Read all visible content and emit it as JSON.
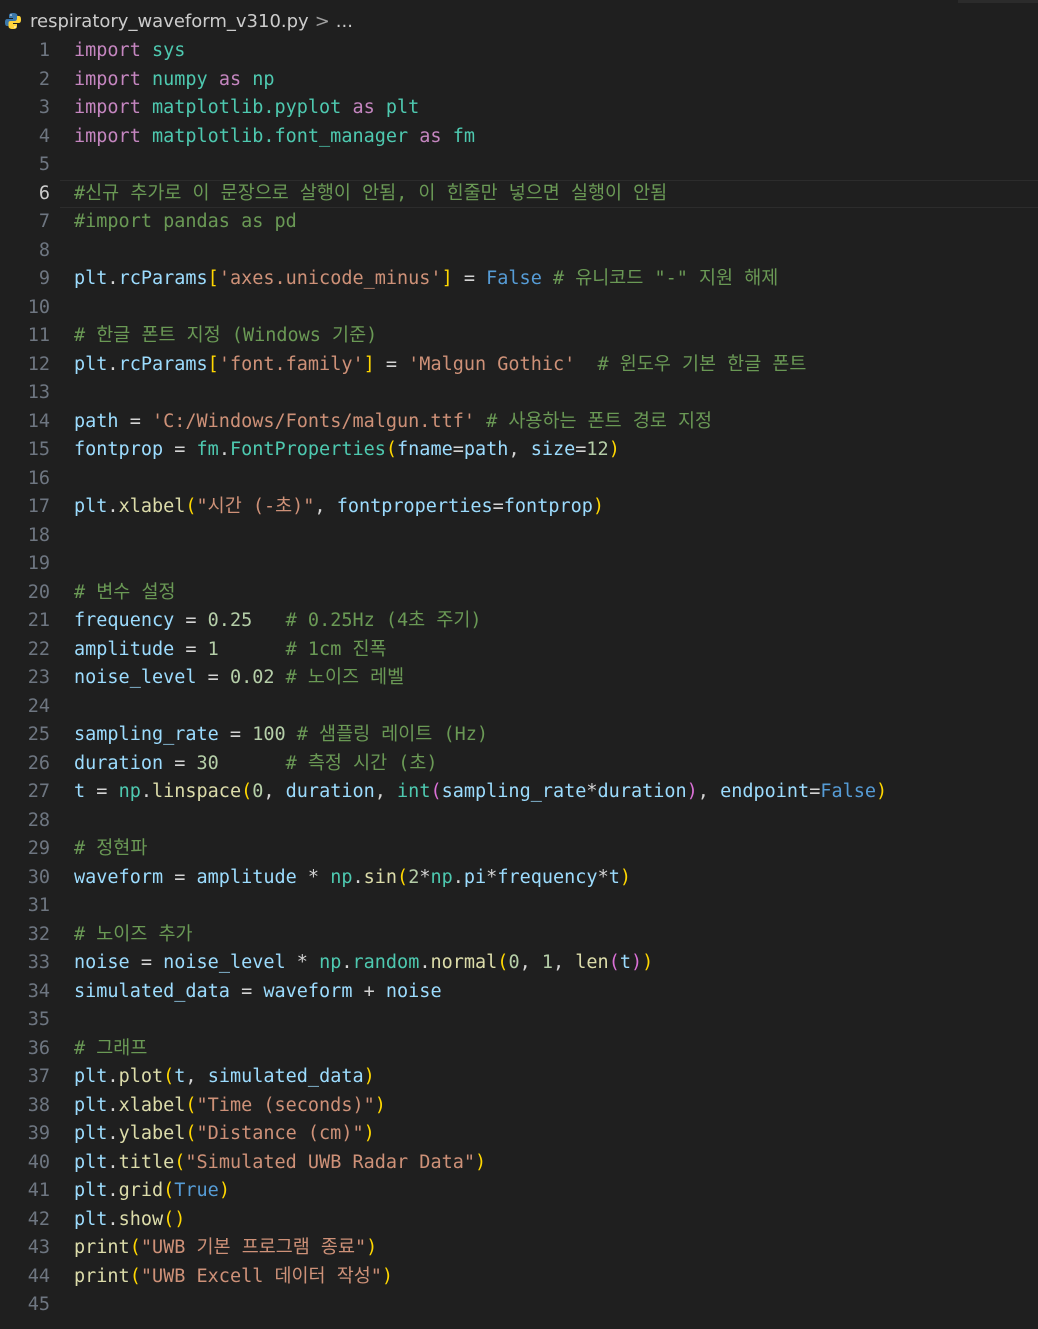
{
  "breadcrumb": {
    "file": "respiratory_waveform_v310.py",
    "separator": ">",
    "more": "..."
  },
  "current_line": 6,
  "lines": [
    [
      [
        "kw",
        "import"
      ],
      [
        "op",
        " "
      ],
      [
        "mod",
        "sys"
      ]
    ],
    [
      [
        "kw",
        "import"
      ],
      [
        "op",
        " "
      ],
      [
        "mod",
        "numpy"
      ],
      [
        "op",
        " "
      ],
      [
        "kw",
        "as"
      ],
      [
        "op",
        " "
      ],
      [
        "mod",
        "np"
      ]
    ],
    [
      [
        "kw",
        "import"
      ],
      [
        "op",
        " "
      ],
      [
        "mod",
        "matplotlib.pyplot"
      ],
      [
        "op",
        " "
      ],
      [
        "kw",
        "as"
      ],
      [
        "op",
        " "
      ],
      [
        "mod",
        "plt"
      ]
    ],
    [
      [
        "kw",
        "import"
      ],
      [
        "op",
        " "
      ],
      [
        "mod",
        "matplotlib.font_manager"
      ],
      [
        "op",
        " "
      ],
      [
        "kw",
        "as"
      ],
      [
        "op",
        " "
      ],
      [
        "mod",
        "fm"
      ]
    ],
    [],
    [
      [
        "cm",
        "#신규 추가로 이 문장으로 살행이 안됨, 이 힌줄만 넣으면 실행이 안됨"
      ]
    ],
    [
      [
        "cm",
        "#import pandas as pd"
      ]
    ],
    [],
    [
      [
        "var",
        "plt"
      ],
      [
        "op",
        "."
      ],
      [
        "var",
        "rcParams"
      ],
      [
        "p1",
        "["
      ],
      [
        "str",
        "'axes.unicode_minus'"
      ],
      [
        "p1",
        "]"
      ],
      [
        "op",
        " = "
      ],
      [
        "bool",
        "False"
      ],
      [
        "op",
        " "
      ],
      [
        "cm",
        "# 유니코드 \"-\" 지원 해제"
      ]
    ],
    [],
    [
      [
        "cm",
        "# 한글 폰트 지정 (Windows 기준)"
      ]
    ],
    [
      [
        "var",
        "plt"
      ],
      [
        "op",
        "."
      ],
      [
        "var",
        "rcParams"
      ],
      [
        "p1",
        "["
      ],
      [
        "str",
        "'font.family'"
      ],
      [
        "p1",
        "]"
      ],
      [
        "op",
        " = "
      ],
      [
        "str",
        "'Malgun Gothic'"
      ],
      [
        "op",
        "  "
      ],
      [
        "cm",
        "# 윈도우 기본 한글 폰트"
      ]
    ],
    [],
    [
      [
        "var",
        "path"
      ],
      [
        "op",
        " = "
      ],
      [
        "str",
        "'C:/Windows/Fonts/malgun.ttf'"
      ],
      [
        "op",
        " "
      ],
      [
        "cm",
        "# 사용하는 폰트 경로 지정"
      ]
    ],
    [
      [
        "var",
        "fontprop"
      ],
      [
        "op",
        " = "
      ],
      [
        "mod",
        "fm"
      ],
      [
        "op",
        "."
      ],
      [
        "mod",
        "FontProperties"
      ],
      [
        "p1",
        "("
      ],
      [
        "var",
        "fname"
      ],
      [
        "op",
        "="
      ],
      [
        "var",
        "path"
      ],
      [
        "op",
        ", "
      ],
      [
        "var",
        "size"
      ],
      [
        "op",
        "="
      ],
      [
        "num",
        "12"
      ],
      [
        "p1",
        ")"
      ]
    ],
    [],
    [
      [
        "var",
        "plt"
      ],
      [
        "op",
        "."
      ],
      [
        "fn",
        "xlabel"
      ],
      [
        "p1",
        "("
      ],
      [
        "str",
        "\"시간 (-초)\""
      ],
      [
        "op",
        ", "
      ],
      [
        "var",
        "fontproperties"
      ],
      [
        "op",
        "="
      ],
      [
        "var",
        "fontprop"
      ],
      [
        "p1",
        ")"
      ]
    ],
    [],
    [],
    [
      [
        "cm",
        "# 변수 설정"
      ]
    ],
    [
      [
        "var",
        "frequency"
      ],
      [
        "op",
        " = "
      ],
      [
        "num",
        "0.25"
      ],
      [
        "op",
        "   "
      ],
      [
        "cm",
        "# 0.25Hz (4초 주기)"
      ]
    ],
    [
      [
        "var",
        "amplitude"
      ],
      [
        "op",
        " = "
      ],
      [
        "num",
        "1"
      ],
      [
        "op",
        "      "
      ],
      [
        "cm",
        "# 1cm 진폭"
      ]
    ],
    [
      [
        "var",
        "noise_level"
      ],
      [
        "op",
        " = "
      ],
      [
        "num",
        "0.02"
      ],
      [
        "op",
        " "
      ],
      [
        "cm",
        "# 노이즈 레벨"
      ]
    ],
    [],
    [
      [
        "var",
        "sampling_rate"
      ],
      [
        "op",
        " = "
      ],
      [
        "num",
        "100"
      ],
      [
        "op",
        " "
      ],
      [
        "cm",
        "# 샘플링 레이트 (Hz)"
      ]
    ],
    [
      [
        "var",
        "duration"
      ],
      [
        "op",
        " = "
      ],
      [
        "num",
        "30"
      ],
      [
        "op",
        "      "
      ],
      [
        "cm",
        "# 측정 시간 (초)"
      ]
    ],
    [
      [
        "var",
        "t"
      ],
      [
        "op",
        " = "
      ],
      [
        "mod",
        "np"
      ],
      [
        "op",
        "."
      ],
      [
        "fn",
        "linspace"
      ],
      [
        "p1",
        "("
      ],
      [
        "num",
        "0"
      ],
      [
        "op",
        ", "
      ],
      [
        "var",
        "duration"
      ],
      [
        "op",
        ", "
      ],
      [
        "mod",
        "int"
      ],
      [
        "p2",
        "("
      ],
      [
        "var",
        "sampling_rate"
      ],
      [
        "op",
        "*"
      ],
      [
        "var",
        "duration"
      ],
      [
        "p2",
        ")"
      ],
      [
        "op",
        ", "
      ],
      [
        "var",
        "endpoint"
      ],
      [
        "op",
        "="
      ],
      [
        "bool",
        "False"
      ],
      [
        "p1",
        ")"
      ]
    ],
    [],
    [
      [
        "cm",
        "# 정현파"
      ]
    ],
    [
      [
        "var",
        "waveform"
      ],
      [
        "op",
        " = "
      ],
      [
        "var",
        "amplitude"
      ],
      [
        "op",
        " * "
      ],
      [
        "mod",
        "np"
      ],
      [
        "op",
        "."
      ],
      [
        "fn",
        "sin"
      ],
      [
        "p1",
        "("
      ],
      [
        "num",
        "2"
      ],
      [
        "op",
        "*"
      ],
      [
        "mod",
        "np"
      ],
      [
        "op",
        "."
      ],
      [
        "var",
        "pi"
      ],
      [
        "op",
        "*"
      ],
      [
        "var",
        "frequency"
      ],
      [
        "op",
        "*"
      ],
      [
        "var",
        "t"
      ],
      [
        "p1",
        ")"
      ]
    ],
    [],
    [
      [
        "cm",
        "# 노이즈 추가"
      ]
    ],
    [
      [
        "var",
        "noise"
      ],
      [
        "op",
        " = "
      ],
      [
        "var",
        "noise_level"
      ],
      [
        "op",
        " * "
      ],
      [
        "mod",
        "np"
      ],
      [
        "op",
        "."
      ],
      [
        "mod",
        "random"
      ],
      [
        "op",
        "."
      ],
      [
        "fn",
        "normal"
      ],
      [
        "p1",
        "("
      ],
      [
        "num",
        "0"
      ],
      [
        "op",
        ", "
      ],
      [
        "num",
        "1"
      ],
      [
        "op",
        ", "
      ],
      [
        "bi",
        "len"
      ],
      [
        "p2",
        "("
      ],
      [
        "var",
        "t"
      ],
      [
        "p2",
        ")"
      ],
      [
        "p1",
        ")"
      ]
    ],
    [
      [
        "var",
        "simulated_data"
      ],
      [
        "op",
        " = "
      ],
      [
        "var",
        "waveform"
      ],
      [
        "op",
        " + "
      ],
      [
        "var",
        "noise"
      ]
    ],
    [],
    [
      [
        "cm",
        "# 그래프"
      ]
    ],
    [
      [
        "var",
        "plt"
      ],
      [
        "op",
        "."
      ],
      [
        "fn",
        "plot"
      ],
      [
        "p1",
        "("
      ],
      [
        "var",
        "t"
      ],
      [
        "op",
        ", "
      ],
      [
        "var",
        "simulated_data"
      ],
      [
        "p1",
        ")"
      ]
    ],
    [
      [
        "var",
        "plt"
      ],
      [
        "op",
        "."
      ],
      [
        "fn",
        "xlabel"
      ],
      [
        "p1",
        "("
      ],
      [
        "str",
        "\"Time (seconds)\""
      ],
      [
        "p1",
        ")"
      ]
    ],
    [
      [
        "var",
        "plt"
      ],
      [
        "op",
        "."
      ],
      [
        "fn",
        "ylabel"
      ],
      [
        "p1",
        "("
      ],
      [
        "str",
        "\"Distance (cm)\""
      ],
      [
        "p1",
        ")"
      ]
    ],
    [
      [
        "var",
        "plt"
      ],
      [
        "op",
        "."
      ],
      [
        "fn",
        "title"
      ],
      [
        "p1",
        "("
      ],
      [
        "str",
        "\"Simulated UWB Radar Data\""
      ],
      [
        "p1",
        ")"
      ]
    ],
    [
      [
        "var",
        "plt"
      ],
      [
        "op",
        "."
      ],
      [
        "fn",
        "grid"
      ],
      [
        "p1",
        "("
      ],
      [
        "bool",
        "True"
      ],
      [
        "p1",
        ")"
      ]
    ],
    [
      [
        "var",
        "plt"
      ],
      [
        "op",
        "."
      ],
      [
        "fn",
        "show"
      ],
      [
        "p1",
        "()"
      ]
    ],
    [
      [
        "fn",
        "print"
      ],
      [
        "p1",
        "("
      ],
      [
        "str",
        "\"UWB 기본 프로그램 종료\""
      ],
      [
        "p1",
        ")"
      ]
    ],
    [
      [
        "fn",
        "print"
      ],
      [
        "p1",
        "("
      ],
      [
        "str",
        "\"UWB Excell 데이터 작성\""
      ],
      [
        "p1",
        ")"
      ]
    ],
    []
  ]
}
